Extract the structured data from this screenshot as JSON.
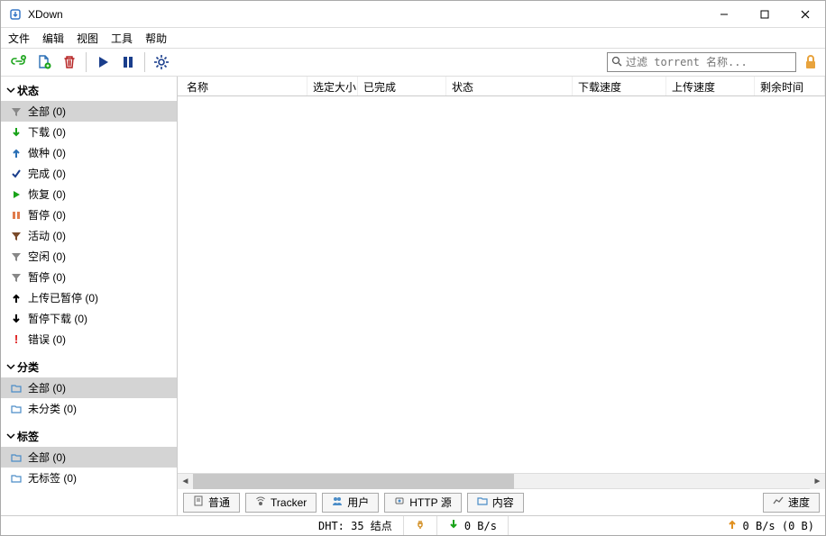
{
  "title": "XDown",
  "menu": {
    "file": "文件",
    "edit": "编辑",
    "view": "视图",
    "tools": "工具",
    "help": "帮助"
  },
  "search_placeholder": "过滤 torrent 名称...",
  "sidebar": {
    "status_header": "状态",
    "status": [
      {
        "label": "全部 (0)"
      },
      {
        "label": "下载 (0)"
      },
      {
        "label": "做种 (0)"
      },
      {
        "label": "完成 (0)"
      },
      {
        "label": "恢复 (0)"
      },
      {
        "label": "暂停 (0)"
      },
      {
        "label": "活动 (0)"
      },
      {
        "label": "空闲 (0)"
      },
      {
        "label": "暂停 (0)"
      },
      {
        "label": "上传已暂停 (0)"
      },
      {
        "label": "暂停下载 (0)"
      },
      {
        "label": "错误 (0)"
      }
    ],
    "category_header": "分类",
    "category": [
      {
        "label": "全部 (0)"
      },
      {
        "label": "未分类 (0)"
      }
    ],
    "tag_header": "标签",
    "tag": [
      {
        "label": "全部 (0)"
      },
      {
        "label": "无标签 (0)"
      }
    ]
  },
  "columns": {
    "name": "名称",
    "size": "选定大小",
    "done": "已完成",
    "status": "状态",
    "down_speed": "下载速度",
    "up_speed": "上传速度",
    "eta": "剩余时间"
  },
  "bottom_tabs": {
    "general": "普通",
    "tracker": "Tracker",
    "users": "用户",
    "http": "HTTP 源",
    "content": "内容",
    "speed": "速度"
  },
  "status": {
    "dht": "DHT: 35 结点",
    "down": "0 B/s",
    "up": "0 B/s (0 B)"
  }
}
